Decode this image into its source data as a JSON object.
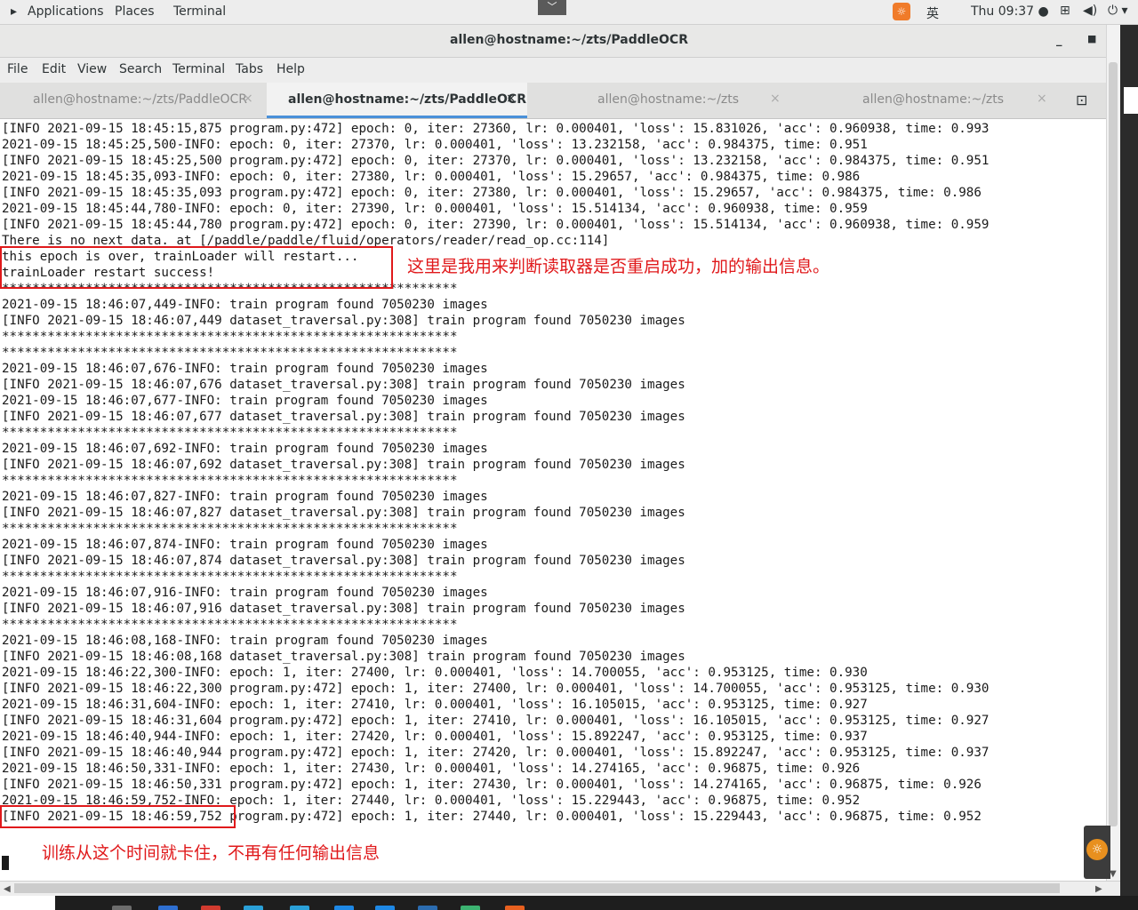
{
  "topbar": {
    "applications": "Applications",
    "places": "Places",
    "terminal": "Terminal",
    "center_button_icon": "chevron-down-icon",
    "input_method": "英",
    "clock": "Thu 09:37",
    "tray_icons": [
      "network-icon",
      "volume-icon",
      "power-icon"
    ]
  },
  "window": {
    "title": "allen@hostname:~/zts/PaddleOCR"
  },
  "menubar": [
    "File",
    "Edit",
    "View",
    "Search",
    "Terminal",
    "Tabs",
    "Help"
  ],
  "tabs": [
    {
      "label": "allen@hostname:~/zts/PaddleOCR",
      "active": false
    },
    {
      "label": "allen@hostname:~/zts/PaddleOCR",
      "active": true
    },
    {
      "label": "allen@hostname:~/zts",
      "active": false
    },
    {
      "label": "allen@hostname:~/zts",
      "active": false
    }
  ],
  "terminal": {
    "lines": [
      "[INFO 2021-09-15 18:45:15,875 program.py:472] epoch: 0, iter: 27360, lr: 0.000401, 'loss': 15.831026, 'acc': 0.960938, time: 0.993",
      "2021-09-15 18:45:25,500-INFO: epoch: 0, iter: 27370, lr: 0.000401, 'loss': 13.232158, 'acc': 0.984375, time: 0.951",
      "[INFO 2021-09-15 18:45:25,500 program.py:472] epoch: 0, iter: 27370, lr: 0.000401, 'loss': 13.232158, 'acc': 0.984375, time: 0.951",
      "2021-09-15 18:45:35,093-INFO: epoch: 0, iter: 27380, lr: 0.000401, 'loss': 15.29657, 'acc': 0.984375, time: 0.986",
      "[INFO 2021-09-15 18:45:35,093 program.py:472] epoch: 0, iter: 27380, lr: 0.000401, 'loss': 15.29657, 'acc': 0.984375, time: 0.986",
      "2021-09-15 18:45:44,780-INFO: epoch: 0, iter: 27390, lr: 0.000401, 'loss': 15.514134, 'acc': 0.960938, time: 0.959",
      "[INFO 2021-09-15 18:45:44,780 program.py:472] epoch: 0, iter: 27390, lr: 0.000401, 'loss': 15.514134, 'acc': 0.960938, time: 0.959",
      "There is no next data. at [/paddle/paddle/fluid/operators/reader/read_op.cc:114]",
      "this epoch is over, trainLoader will restart...",
      "trainLoader restart success!",
      "************************************************************",
      "2021-09-15 18:46:07,449-INFO: train program found 7050230 images",
      "[INFO 2021-09-15 18:46:07,449 dataset_traversal.py:308] train program found 7050230 images",
      "************************************************************",
      "************************************************************",
      "2021-09-15 18:46:07,676-INFO: train program found 7050230 images",
      "[INFO 2021-09-15 18:46:07,676 dataset_traversal.py:308] train program found 7050230 images",
      "2021-09-15 18:46:07,677-INFO: train program found 7050230 images",
      "[INFO 2021-09-15 18:46:07,677 dataset_traversal.py:308] train program found 7050230 images",
      "************************************************************",
      "2021-09-15 18:46:07,692-INFO: train program found 7050230 images",
      "[INFO 2021-09-15 18:46:07,692 dataset_traversal.py:308] train program found 7050230 images",
      "************************************************************",
      "2021-09-15 18:46:07,827-INFO: train program found 7050230 images",
      "[INFO 2021-09-15 18:46:07,827 dataset_traversal.py:308] train program found 7050230 images",
      "************************************************************",
      "2021-09-15 18:46:07,874-INFO: train program found 7050230 images",
      "[INFO 2021-09-15 18:46:07,874 dataset_traversal.py:308] train program found 7050230 images",
      "************************************************************",
      "2021-09-15 18:46:07,916-INFO: train program found 7050230 images",
      "[INFO 2021-09-15 18:46:07,916 dataset_traversal.py:308] train program found 7050230 images",
      "************************************************************",
      "2021-09-15 18:46:08,168-INFO: train program found 7050230 images",
      "[INFO 2021-09-15 18:46:08,168 dataset_traversal.py:308] train program found 7050230 images",
      "2021-09-15 18:46:22,300-INFO: epoch: 1, iter: 27400, lr: 0.000401, 'loss': 14.700055, 'acc': 0.953125, time: 0.930",
      "[INFO 2021-09-15 18:46:22,300 program.py:472] epoch: 1, iter: 27400, lr: 0.000401, 'loss': 14.700055, 'acc': 0.953125, time: 0.930",
      "2021-09-15 18:46:31,604-INFO: epoch: 1, iter: 27410, lr: 0.000401, 'loss': 16.105015, 'acc': 0.953125, time: 0.927",
      "[INFO 2021-09-15 18:46:31,604 program.py:472] epoch: 1, iter: 27410, lr: 0.000401, 'loss': 16.105015, 'acc': 0.953125, time: 0.927",
      "2021-09-15 18:46:40,944-INFO: epoch: 1, iter: 27420, lr: 0.000401, 'loss': 15.892247, 'acc': 0.953125, time: 0.937",
      "[INFO 2021-09-15 18:46:40,944 program.py:472] epoch: 1, iter: 27420, lr: 0.000401, 'loss': 15.892247, 'acc': 0.953125, time: 0.937",
      "2021-09-15 18:46:50,331-INFO: epoch: 1, iter: 27430, lr: 0.000401, 'loss': 14.274165, 'acc': 0.96875, time: 0.926",
      "[INFO 2021-09-15 18:46:50,331 program.py:472] epoch: 1, iter: 27430, lr: 0.000401, 'loss': 14.274165, 'acc': 0.96875, time: 0.926",
      "2021-09-15 18:46:59,752-INFO: epoch: 1, iter: 27440, lr: 0.000401, 'loss': 15.229443, 'acc': 0.96875, time: 0.952",
      "[INFO 2021-09-15 18:46:59,752 program.py:472] epoch: 1, iter: 27440, lr: 0.000401, 'loss': 15.229443, 'acc': 0.96875, time: 0.952"
    ]
  },
  "annotations": {
    "restart_note": "这里是我用来判断读取器是否重启成功，加的输出信息。",
    "stuck_note": "训练从这个时间就卡住，不再有任何输出信息",
    "color": "#e0191b"
  }
}
